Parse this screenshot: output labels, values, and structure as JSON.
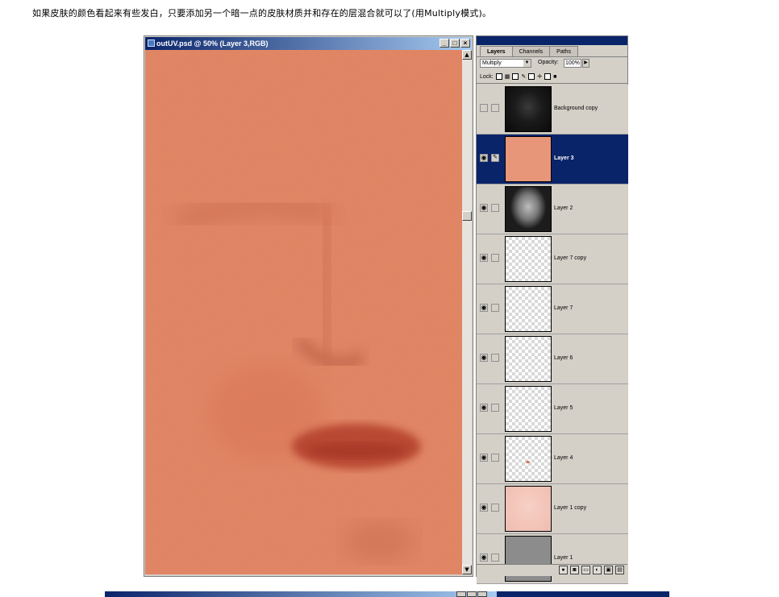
{
  "caption": "如果皮肤的颜色看起来有些发白，只要添加另一个暗一点的皮肤材质并和存在的层混合就可以了(用Multiply模式)。",
  "document": {
    "title": "outUV.psd @ 50% (Layer 3,RGB)",
    "buttons": {
      "minimize": "_",
      "maximize": "□",
      "close": "×"
    },
    "canvas_color": "#e2825f"
  },
  "panel": {
    "tabs": [
      "Layers",
      "Channels",
      "Paths"
    ],
    "blend_mode": "Multiply",
    "opacity_label": "Opacity:",
    "opacity_value": "100%",
    "lock_label": "Lock:",
    "layers": [
      {
        "name": "Background copy",
        "visible": false,
        "selected": false,
        "thumb": "dark-face"
      },
      {
        "name": "Layer 3",
        "visible": true,
        "selected": true,
        "thumb": "skin"
      },
      {
        "name": "Layer 2",
        "visible": true,
        "selected": false,
        "thumb": "grey-head"
      },
      {
        "name": "Layer 7 copy",
        "visible": true,
        "selected": false,
        "thumb": "transparent"
      },
      {
        "name": "Layer 7",
        "visible": true,
        "selected": false,
        "thumb": "transparent"
      },
      {
        "name": "Layer 6",
        "visible": true,
        "selected": false,
        "thumb": "transparent"
      },
      {
        "name": "Layer 5",
        "visible": true,
        "selected": false,
        "thumb": "transparent"
      },
      {
        "name": "Layer 4",
        "visible": true,
        "selected": false,
        "thumb": "transparent-dot"
      },
      {
        "name": "Layer 1 copy",
        "visible": true,
        "selected": false,
        "thumb": "pink"
      },
      {
        "name": "Layer 1",
        "visible": true,
        "selected": false,
        "thumb": "grey"
      }
    ]
  }
}
